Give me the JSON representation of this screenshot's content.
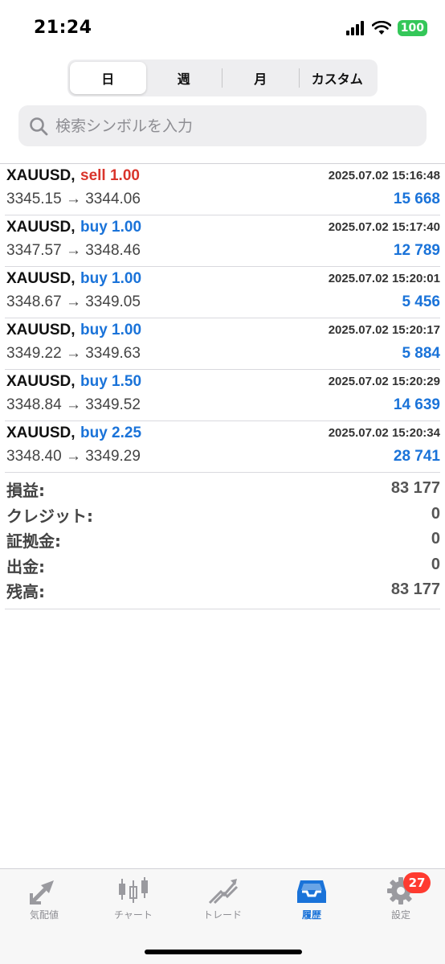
{
  "status_bar": {
    "time": "21:24",
    "battery": "100"
  },
  "period_tabs": [
    {
      "label": "日"
    },
    {
      "label": "週"
    },
    {
      "label": "月"
    },
    {
      "label": "カスタム"
    }
  ],
  "search": {
    "placeholder": "検索シンボルを入力"
  },
  "deals": [
    {
      "symbol": "XAUUSD,",
      "side": "sell 1.00",
      "side_type": "sell",
      "time": "2025.07.02 15:16:48",
      "prices": "3345.15 → 3344.06",
      "profit": "15 668"
    },
    {
      "symbol": "XAUUSD,",
      "side": "buy 1.00",
      "side_type": "buy",
      "time": "2025.07.02 15:17:40",
      "prices": "3347.57 → 3348.46",
      "profit": "12 789"
    },
    {
      "symbol": "XAUUSD,",
      "side": "buy 1.00",
      "side_type": "buy",
      "time": "2025.07.02 15:20:01",
      "prices": "3348.67 → 3349.05",
      "profit": "5 456"
    },
    {
      "symbol": "XAUUSD,",
      "side": "buy 1.00",
      "side_type": "buy",
      "time": "2025.07.02 15:20:17",
      "prices": "3349.22 → 3349.63",
      "profit": "5 884"
    },
    {
      "symbol": "XAUUSD,",
      "side": "buy 1.50",
      "side_type": "buy",
      "time": "2025.07.02 15:20:29",
      "prices": "3348.84 → 3349.52",
      "profit": "14 639"
    },
    {
      "symbol": "XAUUSD,",
      "side": "buy 2.25",
      "side_type": "buy",
      "time": "2025.07.02 15:20:34",
      "prices": "3348.40 → 3349.29",
      "profit": "28 741"
    }
  ],
  "summary": [
    {
      "label": "損益:",
      "value": "83 177"
    },
    {
      "label": "クレジット:",
      "value": "0"
    },
    {
      "label": "証拠金:",
      "value": "0"
    },
    {
      "label": "出金:",
      "value": "0"
    },
    {
      "label": "残高:",
      "value": "83 177"
    }
  ],
  "tab_bar": [
    {
      "label": "気配値",
      "icon": "quotes-arrows-icon"
    },
    {
      "label": "チャート",
      "icon": "candlestick-chart-icon"
    },
    {
      "label": "トレード",
      "icon": "trade-trend-icon"
    },
    {
      "label": "履歴",
      "icon": "history-inbox-icon"
    },
    {
      "label": "設定",
      "icon": "gear-icon",
      "badge": "27"
    }
  ],
  "colors": {
    "sell": "#d9342b",
    "buy": "#1a73d9",
    "active_tab": "#1a73d9",
    "badge": "#ff3b30",
    "battery": "#34c759"
  }
}
